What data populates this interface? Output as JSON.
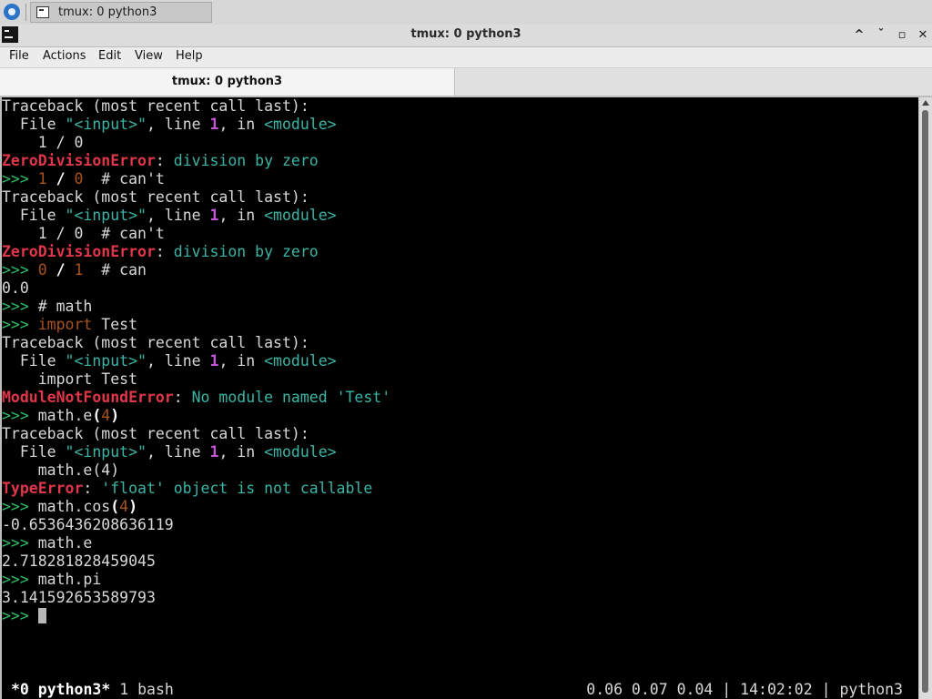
{
  "taskbar": {
    "task_label": "tmux: 0 python3"
  },
  "window": {
    "title": "tmux: 0 python3",
    "buttons": {
      "minimize": "^",
      "restore": "ˇ",
      "maximize": "▫",
      "close": "✕"
    }
  },
  "menubar": {
    "items": [
      "File",
      "Actions",
      "Edit",
      "View",
      "Help"
    ]
  },
  "tab": {
    "label": "tmux: 0 python3"
  },
  "terminal": {
    "lines": [
      [
        [
          "Traceback (most recent call last):",
          "plain"
        ]
      ],
      [
        [
          "  File ",
          "plain"
        ],
        [
          "\"<input>\"",
          "str"
        ],
        [
          ", line ",
          "plain"
        ],
        [
          "1",
          "num"
        ],
        [
          ", in ",
          "plain"
        ],
        [
          "<module>",
          "str"
        ]
      ],
      [
        [
          "    1 / 0",
          "plain"
        ]
      ],
      [
        [
          "ZeroDivisionError",
          "err"
        ],
        [
          ": ",
          "plain"
        ],
        [
          "division by zero",
          "msg"
        ]
      ],
      [
        [
          ">>> ",
          "prompt"
        ],
        [
          "1",
          "num2"
        ],
        [
          " ",
          "plain"
        ],
        [
          "/",
          "bold"
        ],
        [
          " ",
          "plain"
        ],
        [
          "0",
          "num2"
        ],
        [
          "  # can't",
          "plain"
        ]
      ],
      [
        [
          "Traceback (most recent call last):",
          "plain"
        ]
      ],
      [
        [
          "  File ",
          "plain"
        ],
        [
          "\"<input>\"",
          "str"
        ],
        [
          ", line ",
          "plain"
        ],
        [
          "1",
          "num"
        ],
        [
          ", in ",
          "plain"
        ],
        [
          "<module>",
          "str"
        ]
      ],
      [
        [
          "    1 / 0  # can't",
          "plain"
        ]
      ],
      [
        [
          "ZeroDivisionError",
          "err"
        ],
        [
          ": ",
          "plain"
        ],
        [
          "division by zero",
          "msg"
        ]
      ],
      [
        [
          ">>> ",
          "prompt"
        ],
        [
          "0",
          "num2"
        ],
        [
          " ",
          "plain"
        ],
        [
          "/",
          "bold"
        ],
        [
          " ",
          "plain"
        ],
        [
          "1",
          "num2"
        ],
        [
          "  # can",
          "plain"
        ]
      ],
      [
        [
          "0.0",
          "plain"
        ]
      ],
      [
        [
          ">>> ",
          "prompt"
        ],
        [
          "# math",
          "plain"
        ]
      ],
      [
        [
          ">>> ",
          "prompt"
        ],
        [
          "import",
          "kw"
        ],
        [
          " Test",
          "plain"
        ]
      ],
      [
        [
          "Traceback (most recent call last):",
          "plain"
        ]
      ],
      [
        [
          "  File ",
          "plain"
        ],
        [
          "\"<input>\"",
          "str"
        ],
        [
          ", line ",
          "plain"
        ],
        [
          "1",
          "num"
        ],
        [
          ", in ",
          "plain"
        ],
        [
          "<module>",
          "str"
        ]
      ],
      [
        [
          "    import Test",
          "plain"
        ]
      ],
      [
        [
          "ModuleNotFoundError",
          "err"
        ],
        [
          ": ",
          "plain"
        ],
        [
          "No module named 'Test'",
          "msg"
        ]
      ],
      [
        [
          ">>> ",
          "prompt"
        ],
        [
          "math.e",
          "plain"
        ],
        [
          "(",
          "bold"
        ],
        [
          "4",
          "num2"
        ],
        [
          ")",
          "bold"
        ]
      ],
      [
        [
          "Traceback (most recent call last):",
          "plain"
        ]
      ],
      [
        [
          "  File ",
          "plain"
        ],
        [
          "\"<input>\"",
          "str"
        ],
        [
          ", line ",
          "plain"
        ],
        [
          "1",
          "num"
        ],
        [
          ", in ",
          "plain"
        ],
        [
          "<module>",
          "str"
        ]
      ],
      [
        [
          "    math.e(4)",
          "plain"
        ]
      ],
      [
        [
          "TypeError",
          "err"
        ],
        [
          ": ",
          "plain"
        ],
        [
          "'float' object is not callable",
          "msg"
        ]
      ],
      [
        [
          ">>> ",
          "prompt"
        ],
        [
          "math.cos",
          "plain"
        ],
        [
          "(",
          "bold"
        ],
        [
          "4",
          "num2"
        ],
        [
          ")",
          "bold"
        ]
      ],
      [
        [
          "-0.6536436208636119",
          "plain"
        ]
      ],
      [
        [
          ">>> ",
          "prompt"
        ],
        [
          "math.e",
          "plain"
        ]
      ],
      [
        [
          "2.718281828459045",
          "plain"
        ]
      ],
      [
        [
          ">>> ",
          "prompt"
        ],
        [
          "math.pi",
          "plain"
        ]
      ],
      [
        [
          "3.141592653589793",
          "plain"
        ]
      ],
      [
        [
          ">>> ",
          "prompt"
        ],
        [
          "",
          "cursor"
        ]
      ]
    ]
  },
  "status": {
    "current_window": "*0 python3*",
    "other_window": "1 bash",
    "load": "0.06 0.07 0.04",
    "sep": "|",
    "time": "14:02:02",
    "host": "python3"
  }
}
